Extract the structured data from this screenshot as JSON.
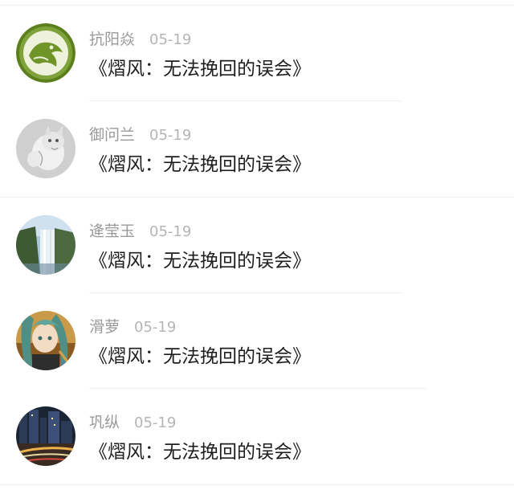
{
  "comments": [
    {
      "author": "抗阳焱",
      "date": "05-19",
      "title": "《熠风：无法挽回的误会》",
      "avatar": "green-bird-avatar"
    },
    {
      "author": "御问兰",
      "date": "05-19",
      "title": "《熠风：无法挽回的误会》",
      "avatar": "kitten-avatar"
    },
    {
      "author": "逄莹玉",
      "date": "05-19",
      "title": "《熠风：无法挽回的误会》",
      "avatar": "waterfall-avatar"
    },
    {
      "author": "滑萝",
      "date": "05-19",
      "title": "《熠风：无法挽回的误会》",
      "avatar": "anime-girl-avatar"
    },
    {
      "author": "巩纵",
      "date": "05-19",
      "title": "《熠风：无法挽回的误会》",
      "avatar": "city-night-avatar"
    }
  ]
}
